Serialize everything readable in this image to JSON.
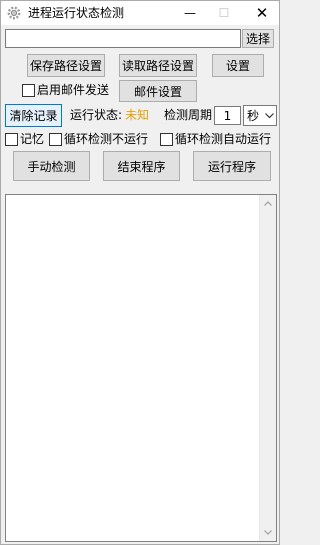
{
  "window": {
    "title": "进程运行状态检测",
    "minimize_glyph": "—",
    "maximize_glyph": "☐",
    "close_glyph": "✕"
  },
  "path": {
    "value": "",
    "placeholder": "",
    "browse_label": "选择"
  },
  "buttons": {
    "save_path": "保存路径设置",
    "read_path": "读取路径设置",
    "settings": "设置",
    "mail_settings": "邮件设置",
    "clear_log": "清除记录",
    "manual_check": "手动检测",
    "end_program": "结束程序",
    "run_program": "运行程序"
  },
  "options": {
    "enable_mail": "启用邮件发送",
    "memory": "记忆",
    "loop_no_run": "循环检测不运行",
    "loop_auto_run": "循环检测自动运行"
  },
  "status": {
    "label": "运行状态:",
    "value": "未知",
    "value_color": "#e8a000",
    "period_label": "检测周期",
    "period_value": "1",
    "unit_selected": "秒"
  },
  "log": {
    "text": ""
  }
}
